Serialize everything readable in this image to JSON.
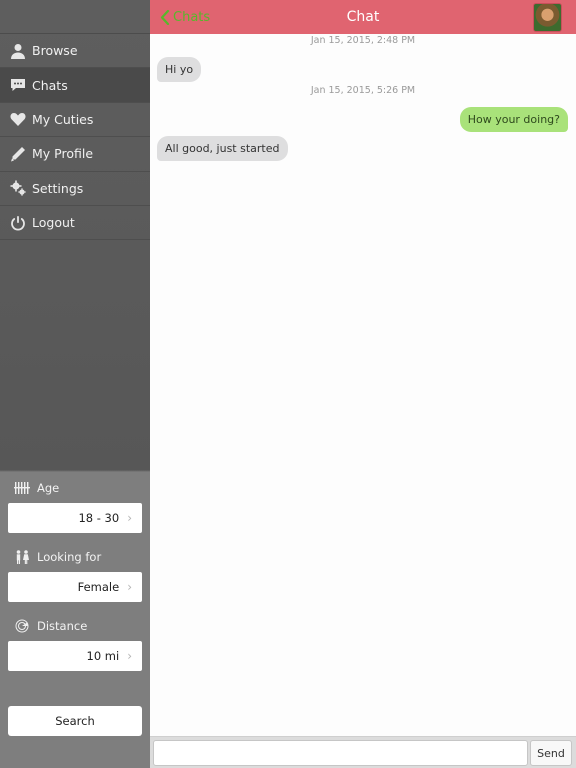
{
  "sidebar": {
    "items": [
      {
        "label": "Browse",
        "icon": "person-icon"
      },
      {
        "label": "Chats",
        "icon": "chat-bubble-icon"
      },
      {
        "label": "My Cuties",
        "icon": "heart-icon"
      },
      {
        "label": "My Profile",
        "icon": "pencil-icon"
      },
      {
        "label": "Settings",
        "icon": "gears-icon"
      },
      {
        "label": "Logout",
        "icon": "power-icon"
      }
    ],
    "active_item": "Chats",
    "filters": {
      "age": {
        "label": "Age",
        "value": "18 - 30"
      },
      "looking_for": {
        "label": "Looking for",
        "value": "Female"
      },
      "distance": {
        "label": "Distance",
        "value": "10 mi"
      }
    },
    "search_label": "Search"
  },
  "header": {
    "back_label": "Chats",
    "title": "Chat",
    "accent_color": "#e06470",
    "back_color": "#58b82b"
  },
  "messages": [
    {
      "type": "timestamp",
      "text": "Jan 15, 2015, 2:48 PM"
    },
    {
      "type": "incoming",
      "text": "Hi yo"
    },
    {
      "type": "timestamp",
      "text": "Jan 15, 2015, 5:26 PM"
    },
    {
      "type": "outgoing",
      "text": "How your doing?"
    },
    {
      "type": "incoming",
      "text": "All good, just started"
    }
  ],
  "composer": {
    "placeholder": "",
    "send_label": "Send"
  }
}
